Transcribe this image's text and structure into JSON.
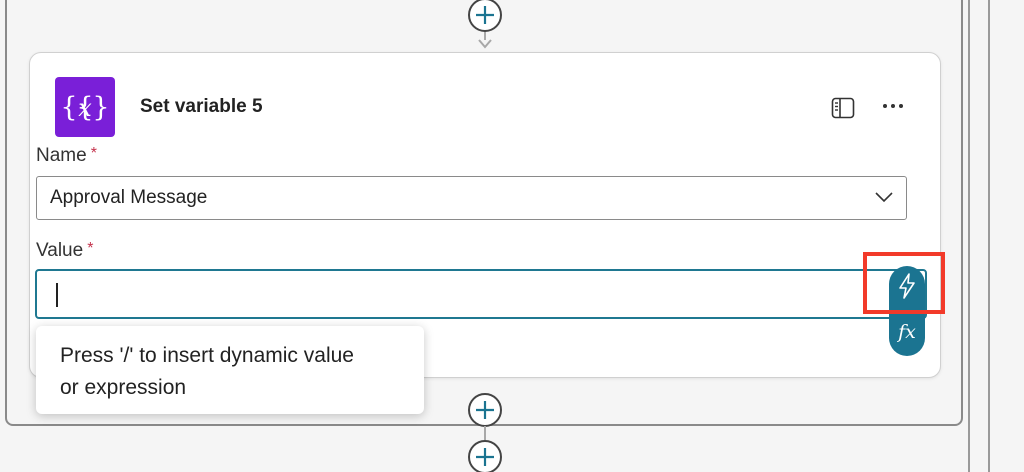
{
  "card": {
    "title": "Set variable 5",
    "icon": "variable-braces-icon",
    "icon_bg": "#7a1fd8"
  },
  "fields": {
    "name": {
      "label": "Name",
      "required_mark": "*",
      "value": "Approval Message"
    },
    "value": {
      "label": "Value",
      "required_mark": "*",
      "value": ""
    }
  },
  "tooltip": {
    "line1": "Press '/' to insert dynamic value",
    "line2": "or expression"
  },
  "side_buttons": {
    "dynamic": "lightning-icon",
    "expression_label": "fx"
  },
  "colors": {
    "accent": "#1b7491",
    "required": "#c4314b",
    "highlight": "#f23a2a"
  }
}
